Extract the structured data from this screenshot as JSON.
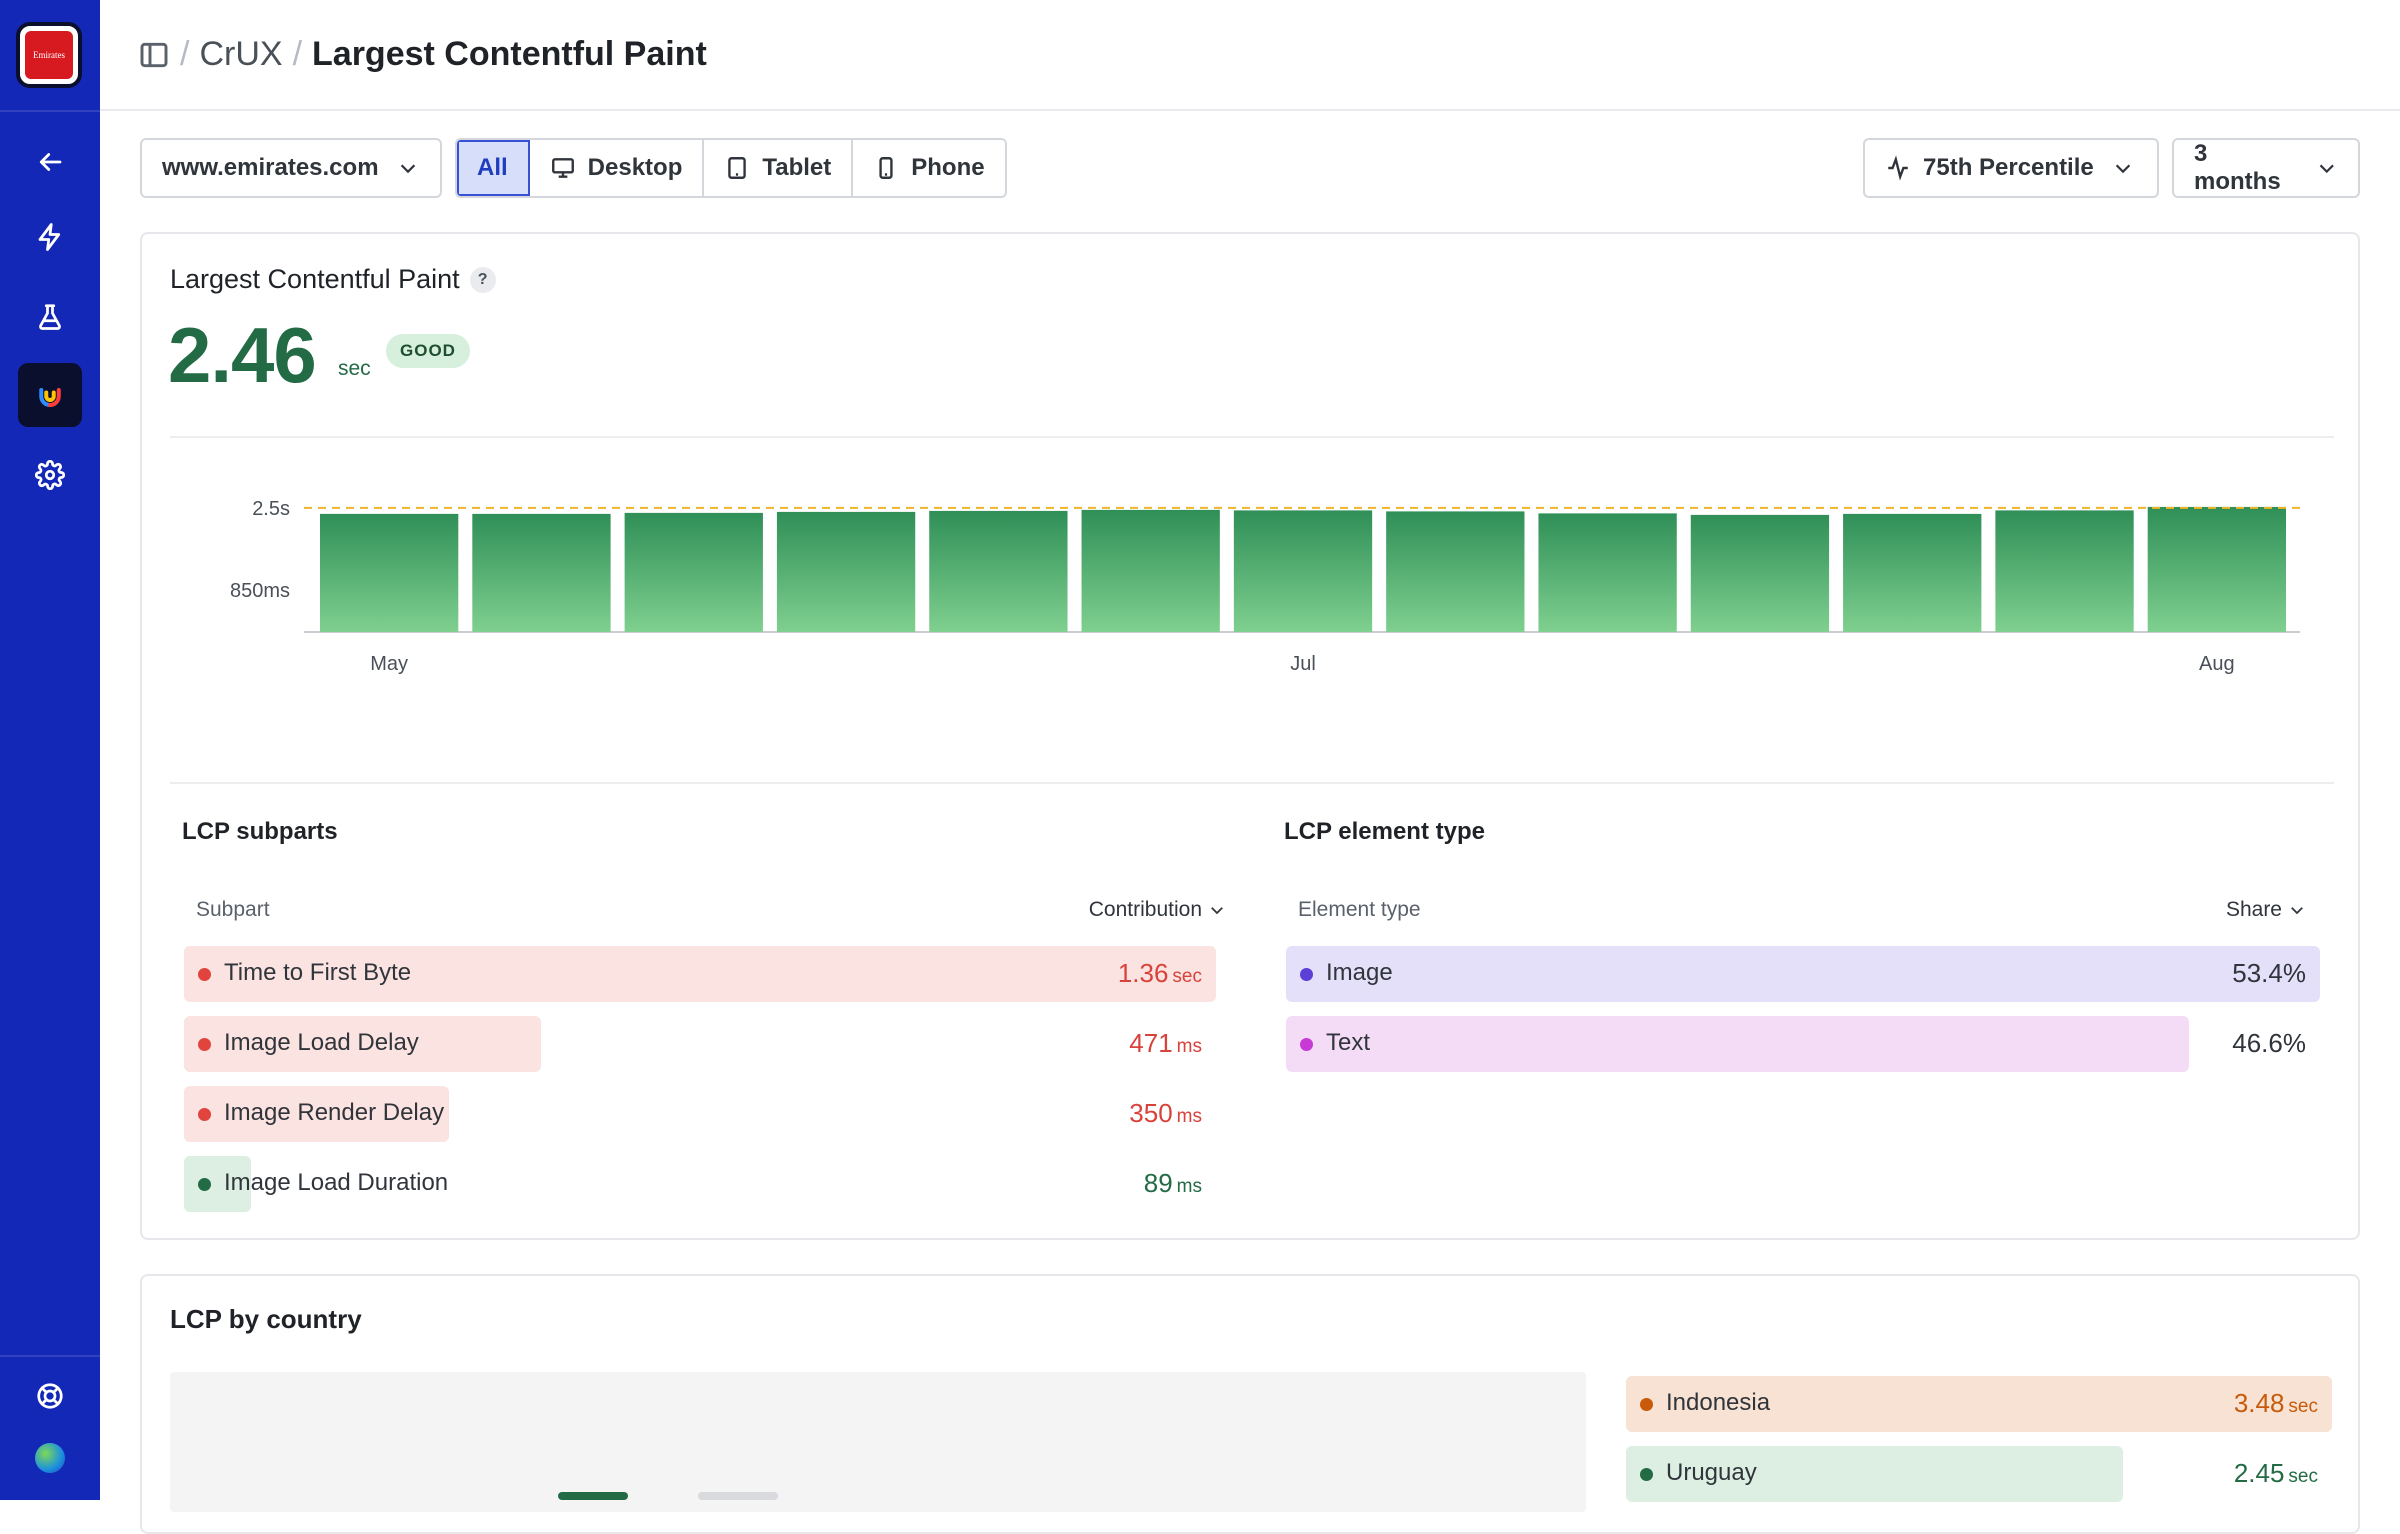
{
  "sidebar": {
    "brand_text": "Emirates",
    "items": [
      {
        "icon": "back-arrow-icon"
      },
      {
        "icon": "lightning-icon"
      },
      {
        "icon": "flask-icon"
      },
      {
        "icon": "crux-logo-icon",
        "active": true
      },
      {
        "icon": "gear-icon"
      }
    ],
    "bottom": [
      {
        "icon": "help-lifebuoy-icon"
      },
      {
        "icon": "user-avatar"
      }
    ]
  },
  "header": {
    "crumb": "CrUX",
    "title": "Largest Contentful Paint"
  },
  "toolbar": {
    "site": "www.emirates.com",
    "devices": [
      "All",
      "Desktop",
      "Tablet",
      "Phone"
    ],
    "active_device": "All",
    "percentile": "75th Percentile",
    "range": "3 months"
  },
  "metric": {
    "title": "Largest Contentful Paint",
    "help": "?",
    "value": "2.46",
    "unit": "sec",
    "status": "GOOD",
    "colors": {
      "good": "#226b45",
      "poor": "#d9423b",
      "threshold": "#f0b429"
    }
  },
  "chart_data": {
    "type": "bar",
    "x_labels": [
      "May",
      "Jul",
      "Aug"
    ],
    "y_ticks": [
      "2.5s",
      "850ms"
    ],
    "values": [
      2.38,
      2.38,
      2.4,
      2.42,
      2.44,
      2.46,
      2.45,
      2.43,
      2.39,
      2.36,
      2.38,
      2.45,
      2.52
    ],
    "threshold": 2.5,
    "ylim": [
      0,
      2.7
    ]
  },
  "subparts": {
    "title": "LCP subparts",
    "col_name": "Subpart",
    "col_value": "Contribution",
    "rows": [
      {
        "label": "Time to First Byte",
        "value": "1.36",
        "unit": "sec",
        "share": 1.0,
        "status": "poor"
      },
      {
        "label": "Image Load Delay",
        "value": "471",
        "unit": "ms",
        "share": 0.346,
        "status": "poor"
      },
      {
        "label": "Image Render Delay",
        "value": "350",
        "unit": "ms",
        "share": 0.257,
        "status": "poor"
      },
      {
        "label": "Image Load Duration",
        "value": "89",
        "unit": "ms",
        "share": 0.065,
        "status": "good"
      }
    ]
  },
  "element_type": {
    "title": "LCP element type",
    "col_name": "Element type",
    "col_value": "Share",
    "rows": [
      {
        "label": "Image",
        "value": "53.4%",
        "share": 1.0,
        "color": "#5b3fd6",
        "bg": "#e4e0f9"
      },
      {
        "label": "Text",
        "value": "46.6%",
        "share": 0.873,
        "color": "#c83ad6",
        "bg": "#f4dcf7"
      }
    ]
  },
  "country": {
    "title": "LCP by country",
    "rows": [
      {
        "label": "Indonesia",
        "value": "3.48",
        "unit": "sec",
        "share": 1.0,
        "status": "warn"
      },
      {
        "label": "Uruguay",
        "value": "2.45",
        "unit": "sec",
        "share": 0.704,
        "status": "good"
      }
    ]
  }
}
